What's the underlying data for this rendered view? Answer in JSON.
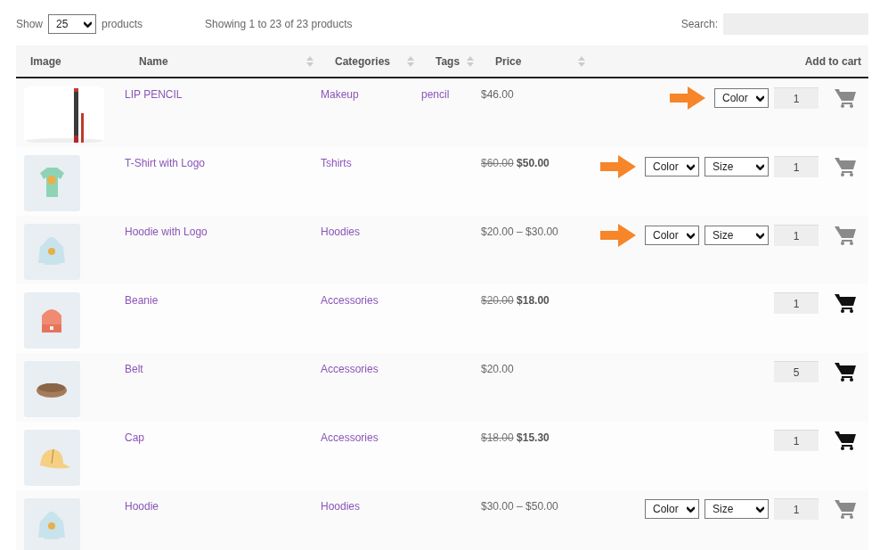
{
  "length_control": {
    "prefix": "Show",
    "value": "25",
    "suffix": "products"
  },
  "info": "Showing 1 to 23 of 23 products",
  "search": {
    "label": "Search:"
  },
  "table": {
    "columns": [
      {
        "label": "Image",
        "sortable": false
      },
      {
        "label": "Name",
        "sortable": true
      },
      {
        "label": "Categories",
        "sortable": true
      },
      {
        "label": "Tags",
        "sortable": true
      },
      {
        "label": "Price",
        "sortable": true
      },
      {
        "label": "Add to cart",
        "sortable": false
      }
    ],
    "rows": [
      {
        "image": {
          "kind": "picture"
        },
        "name": "LIP PENCIL",
        "category": "Makeup",
        "tags": "pencil",
        "price": "$46.00",
        "highlighted": true,
        "options": [
          "Color"
        ],
        "quantity": "1",
        "cart_disabled": true
      },
      {
        "image": {
          "kind": "picture"
        },
        "name": "T-Shirt with Logo",
        "category": "Tshirts",
        "old_price": "$60.00",
        "price": "$50.00",
        "highlighted": true,
        "options": [
          "Color",
          "Size"
        ],
        "quantity": "1",
        "cart_disabled": true
      },
      {
        "image": {
          "kind": "picture"
        },
        "name": "Hoodie with Logo",
        "category": "Hoodies",
        "price": "$20.00 – $30.00",
        "highlighted": true,
        "options": [
          "Color",
          "Size"
        ],
        "quantity": "1",
        "cart_disabled": true
      },
      {
        "image": {
          "kind": "picture"
        },
        "name": "Beanie",
        "category": "Accessories",
        "old_price": "$20.00",
        "price": "$18.00",
        "highlighted": false,
        "quantity": "1",
        "cart_disabled": false
      },
      {
        "image": {
          "kind": "picture"
        },
        "name": "Belt",
        "category": "Accessories",
        "price": "$20.00",
        "highlighted": false,
        "quantity": "5",
        "cart_disabled": false
      },
      {
        "image": {
          "kind": "picture"
        },
        "name": "Cap",
        "category": "Accessories",
        "old_price": "$18.00",
        "price": "$15.30",
        "highlighted": false,
        "quantity": "1",
        "cart_disabled": false
      },
      {
        "image": {
          "kind": "picture"
        },
        "name": "Hoodie",
        "category": "Hoodies",
        "price": "$30.00 – $50.00",
        "highlighted": false,
        "options": [
          "Color",
          "Size"
        ],
        "quantity": "1",
        "cart_disabled": true
      }
    ]
  }
}
